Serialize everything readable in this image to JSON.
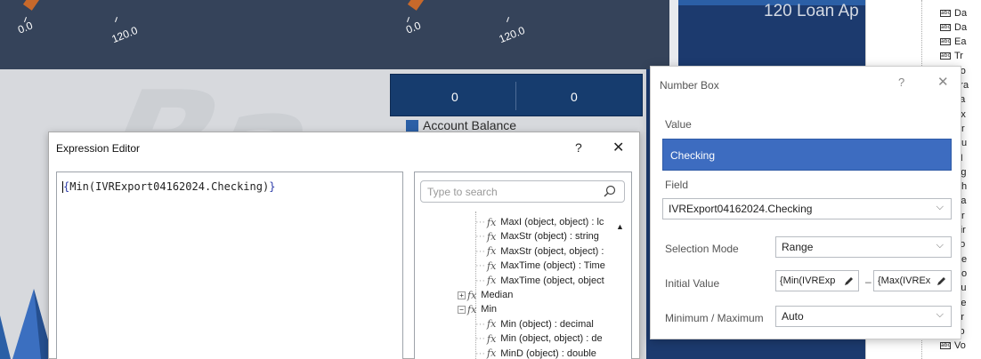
{
  "dashboard": {
    "gauge1_min": "0.0",
    "gauge1_max": "120.0",
    "gauge2_min": "0.0",
    "gauge2_max": "120.0",
    "loan_title": "120 Loan Ap",
    "kpi_left": "0",
    "kpi_right": "0",
    "legend_label": "Account Balance",
    "colors": {
      "dark_panel": "#35435a",
      "navy": "#1c3a6e",
      "accent_orange": "#c8692b",
      "series_blue": "#2b5fa6"
    }
  },
  "field_list": {
    "items": [
      "Da",
      "Da",
      "Ea",
      "Tr",
      "Vo",
      "Tra",
      "La",
      "Ex",
      "Cr",
      "Cu",
      "ZI",
      "Ag",
      "Ch",
      "Sa",
      "Cr",
      "Fir",
      "Lo",
      "Ce",
      "Ho",
      "Au",
      "Pe",
      "Pr",
      "co",
      "Vo"
    ]
  },
  "expression_editor": {
    "title": "Expression Editor",
    "help": "?",
    "close": "✕",
    "expression_open": "{",
    "expression_body": "Min(IVRExport04162024.Checking)",
    "expression_close": "}",
    "search_placeholder": "Type to search",
    "tree": [
      {
        "label": "MaxI (object, object) : lc",
        "type": "function"
      },
      {
        "label": "MaxStr (object) : string",
        "type": "function"
      },
      {
        "label": "MaxStr (object, object) :",
        "type": "function"
      },
      {
        "label": "MaxTime (object) : Time",
        "type": "function"
      },
      {
        "label": "MaxTime (object, object",
        "type": "function"
      },
      {
        "label": "Median",
        "type": "group",
        "expander": "+"
      },
      {
        "label": "Min",
        "type": "group",
        "expander": "−"
      },
      {
        "label": "Min (object) : decimal",
        "type": "function"
      },
      {
        "label": "Min (object, object) : de",
        "type": "function"
      },
      {
        "label": "MinD (object) : double",
        "type": "function"
      }
    ]
  },
  "number_box": {
    "title": "Number Box",
    "help": "?",
    "close": "✕",
    "value_label": "Value",
    "value": "Checking",
    "field_label": "Field",
    "field_value": "IVRExport04162024.Checking",
    "selection_mode_label": "Selection Mode",
    "selection_mode_value": "Range",
    "initial_value_label": "Initial Value",
    "initial_min": "{Min(IVRExp",
    "initial_max": "{Max(IVREx",
    "initial_separator": "–",
    "min_max_label": "Minimum / Maximum",
    "min_max_value": "Auto"
  }
}
